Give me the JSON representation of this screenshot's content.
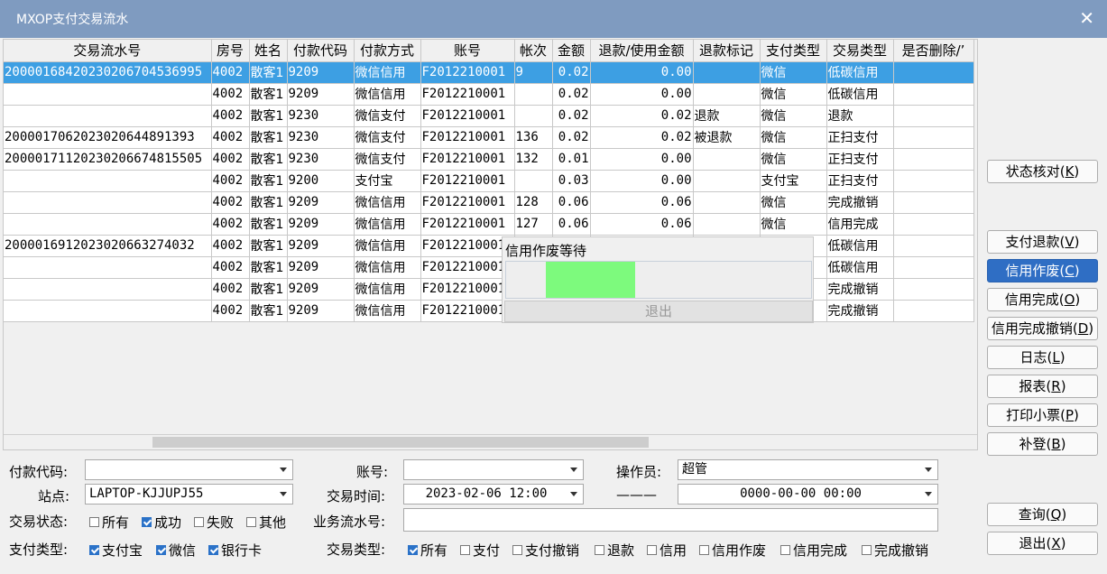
{
  "window": {
    "title": "MXOP支付交易流水",
    "close_glyph": "✕"
  },
  "grid": {
    "columns": [
      "交易流水号",
      "房号",
      "姓名",
      "付款代码",
      "付款方式",
      "账号",
      "帐次",
      "金额",
      "退款/使用金额",
      "退款标记",
      "支付类型",
      "交易类型",
      "是否删除/’"
    ],
    "rows": [
      [
        "20000168420230206704536995",
        "4002",
        "散客1",
        "9209",
        "微信信用",
        "F2012210001",
        "9",
        "0.02",
        "0.00",
        "",
        "微信",
        "低碳信用",
        ""
      ],
      [
        "",
        "4002",
        "散客1",
        "9209",
        "微信信用",
        "F2012210001",
        "",
        "0.02",
        "0.00",
        "",
        "微信",
        "低碳信用",
        ""
      ],
      [
        "",
        "4002",
        "散客1",
        "9230",
        "微信支付",
        "F2012210001",
        "",
        "0.02",
        "0.02",
        "退款",
        "微信",
        "退款",
        ""
      ],
      [
        "2000017062023020644891393",
        "4002",
        "散客1",
        "9230",
        "微信支付",
        "F2012210001",
        "136",
        "0.02",
        "0.02",
        "被退款",
        "微信",
        "正扫支付",
        ""
      ],
      [
        "20000171120230206674815505",
        "4002",
        "散客1",
        "9230",
        "微信支付",
        "F2012210001",
        "132",
        "0.01",
        "0.00",
        "",
        "微信",
        "正扫支付",
        ""
      ],
      [
        "",
        "4002",
        "散客1",
        "9200",
        "支付宝",
        "F2012210001",
        "",
        "0.03",
        "0.00",
        "",
        "支付宝",
        "正扫支付",
        ""
      ],
      [
        "",
        "4002",
        "散客1",
        "9209",
        "微信信用",
        "F2012210001",
        "128",
        "0.06",
        "0.06",
        "",
        "微信",
        "完成撤销",
        ""
      ],
      [
        "",
        "4002",
        "散客1",
        "9209",
        "微信信用",
        "F2012210001",
        "127",
        "0.06",
        "0.06",
        "",
        "微信",
        "信用完成",
        ""
      ],
      [
        "2000016912023020663274032",
        "4002",
        "散客1",
        "9209",
        "微信信用",
        "F2012210001",
        "",
        "",
        "",
        "",
        "",
        "低碳信用",
        ""
      ],
      [
        "",
        "4002",
        "散客1",
        "9209",
        "微信信用",
        "F2012210001",
        "",
        "",
        "",
        "",
        "",
        "低碳信用",
        ""
      ],
      [
        "",
        "4002",
        "散客1",
        "9209",
        "微信信用",
        "F2012210001",
        "",
        "",
        "",
        "",
        "",
        "完成撤销",
        ""
      ],
      [
        "",
        "4002",
        "散客1",
        "9209",
        "微信信用",
        "F2012210001",
        "",
        "",
        "",
        "",
        "",
        "完成撤销",
        ""
      ]
    ]
  },
  "popup": {
    "title": "信用作废等待",
    "exit_label": "退出",
    "progress_fraction": 0.29
  },
  "actions": [
    {
      "label": "状态核对",
      "key": "K",
      "active": false
    },
    {
      "label": "支付退款",
      "key": "V",
      "active": false
    },
    {
      "label": "信用作废",
      "key": "C",
      "active": true
    },
    {
      "label": "信用完成",
      "key": "O",
      "active": false
    },
    {
      "label": "信用完成撤销",
      "key": "D",
      "active": false
    },
    {
      "label": "日志",
      "key": "L",
      "active": false
    },
    {
      "label": "报表",
      "key": "R",
      "active": false
    },
    {
      "label": "打印小票",
      "key": "P",
      "active": false
    },
    {
      "label": "补登",
      "key": "B",
      "active": false
    },
    {
      "label": "查询",
      "key": "Q",
      "active": false
    },
    {
      "label": "退出",
      "key": "X",
      "active": false
    }
  ],
  "filters": {
    "pay_code_label": "付款代码:",
    "pay_code_value": "",
    "account_label": "账号:",
    "account_value": "",
    "operator_label": "操作员:",
    "operator_value": "超管",
    "site_label": "站点:",
    "site_value": "LAPTOP-KJJUPJ55",
    "time_label": "交易时间:",
    "time_value": "2023-02-06 12:00",
    "range_separator": "———",
    "time_end_value": "0000-00-00 00:00",
    "status_label": "交易状态:",
    "status_options": [
      {
        "label": "所有",
        "checked": false
      },
      {
        "label": "成功",
        "checked": true
      },
      {
        "label": "失败",
        "checked": false
      },
      {
        "label": "其他",
        "checked": false
      }
    ],
    "serial_label": "业务流水号:",
    "serial_value": "",
    "paytype_label": "支付类型:",
    "paytype_options": [
      {
        "label": "支付宝",
        "checked": true
      },
      {
        "label": "微信",
        "checked": true
      },
      {
        "label": "银行卡",
        "checked": true
      }
    ],
    "txtype_label": "交易类型:",
    "txtype_options": [
      {
        "label": "所有",
        "checked": true
      },
      {
        "label": "支付",
        "checked": false
      },
      {
        "label": "支付撤销",
        "checked": false
      },
      {
        "label": "退款",
        "checked": false
      },
      {
        "label": "信用",
        "checked": false
      },
      {
        "label": "信用作废",
        "checked": false
      },
      {
        "label": "信用完成",
        "checked": false
      },
      {
        "label": "完成撤销",
        "checked": false
      }
    ]
  },
  "colors": {
    "titlebar": "#7f9bc0",
    "selected_row": "#3d9fe3",
    "active_button": "#2f6ec4",
    "progress_fill": "#7dfa7d"
  }
}
